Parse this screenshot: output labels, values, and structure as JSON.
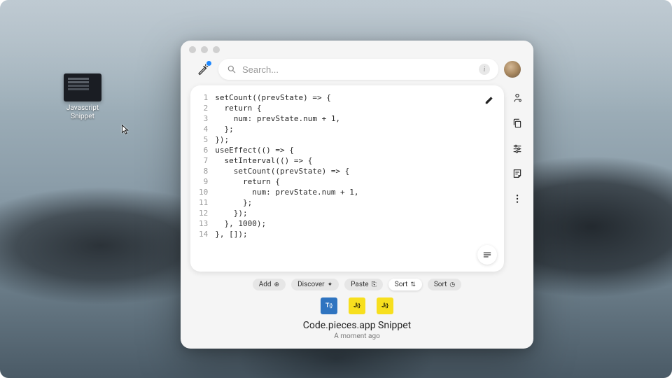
{
  "desktop_icon": {
    "label": "Javascript\nSnippet"
  },
  "search": {
    "placeholder": "Search..."
  },
  "code": {
    "lines": [
      "setCount((prevState) => {",
      "  return {",
      "    num: prevState.num + 1,",
      "  };",
      "});",
      "useEffect(() => {",
      "  setInterval(() => {",
      "    setCount((prevState) => {",
      "      return {",
      "        num: prevState.num + 1,",
      "      };",
      "    });",
      "  }, 1000);",
      "}, []);"
    ]
  },
  "actions": {
    "add": "Add",
    "discover": "Discover",
    "paste": "Paste",
    "sort_primary": "Sort",
    "sort_secondary": "Sort"
  },
  "thumbnails": {
    "ts": "T",
    "js1": "J",
    "js2": "J"
  },
  "footer": {
    "title": "Code.pieces.app Snippet",
    "timestamp": "A moment ago"
  }
}
